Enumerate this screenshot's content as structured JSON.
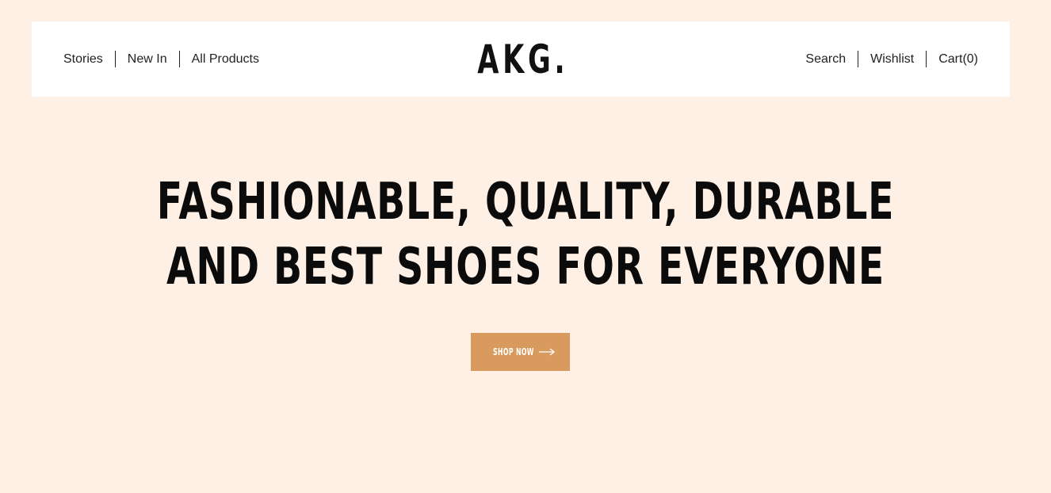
{
  "header": {
    "left_nav": [
      {
        "label": "Stories"
      },
      {
        "label": "New In"
      },
      {
        "label": "All Products"
      }
    ],
    "logo": "AKG.",
    "right_nav": {
      "search_label": "Search",
      "wishlist_label": "Wishlist",
      "cart_label": "Cart(0)"
    }
  },
  "hero": {
    "title": "FASHIONABLE, QUALITY, DURABLE AND BEST SHOES FOR EVERYONE",
    "cta_label": "SHOP NOW",
    "cta_icon": "arrow-right-icon"
  },
  "colors": {
    "background": "#fff0e5",
    "header_bg": "#ffffff",
    "accent": "#d99a5e",
    "text": "#111111"
  }
}
